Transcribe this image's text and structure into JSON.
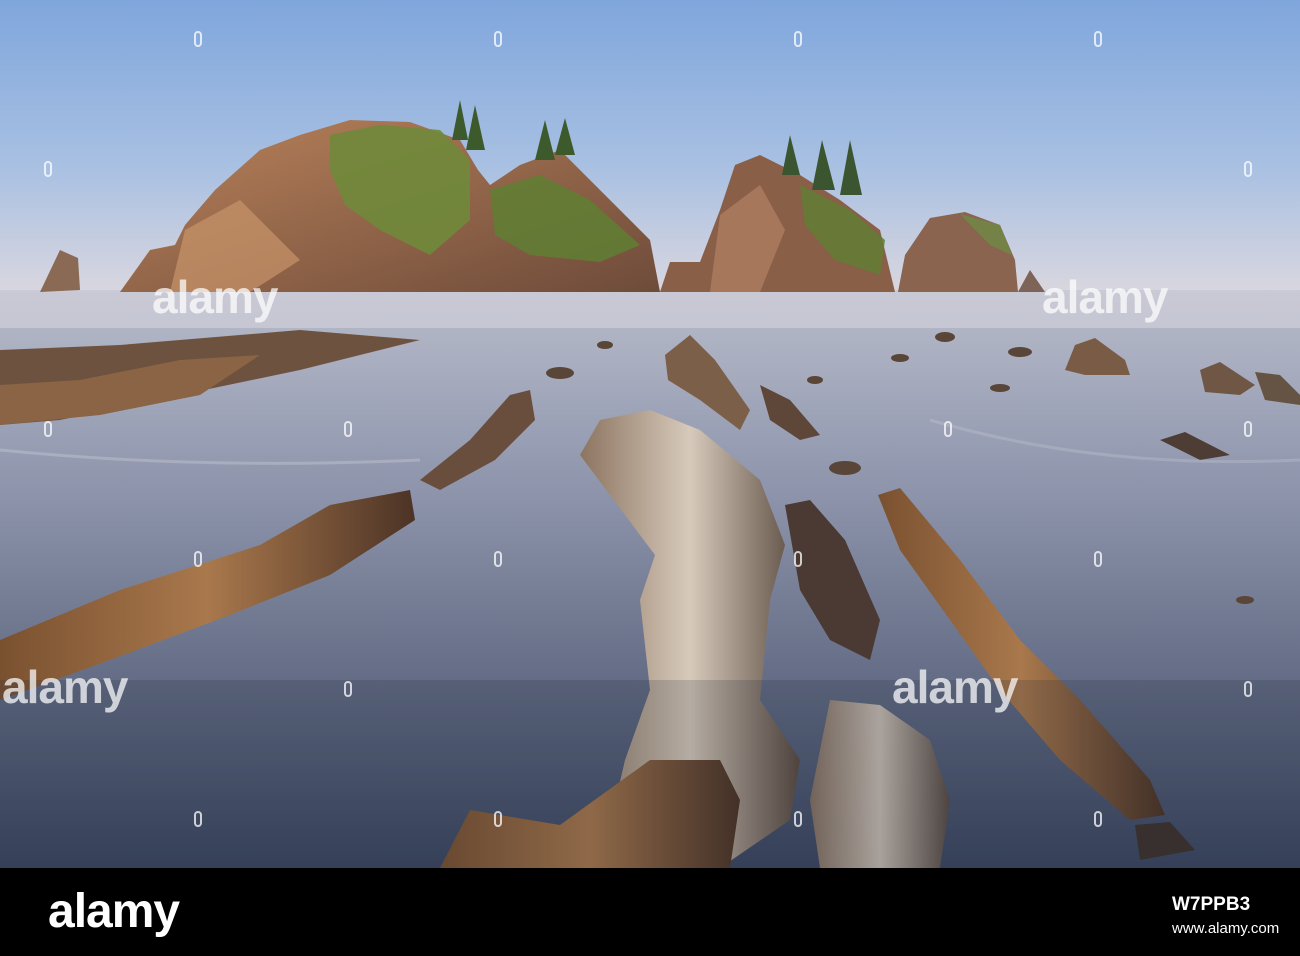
{
  "watermark": {
    "word": "alamy"
  },
  "footer": {
    "logo": "alamy",
    "image_id": "W7PPB3",
    "url": "www.alamy.com"
  }
}
